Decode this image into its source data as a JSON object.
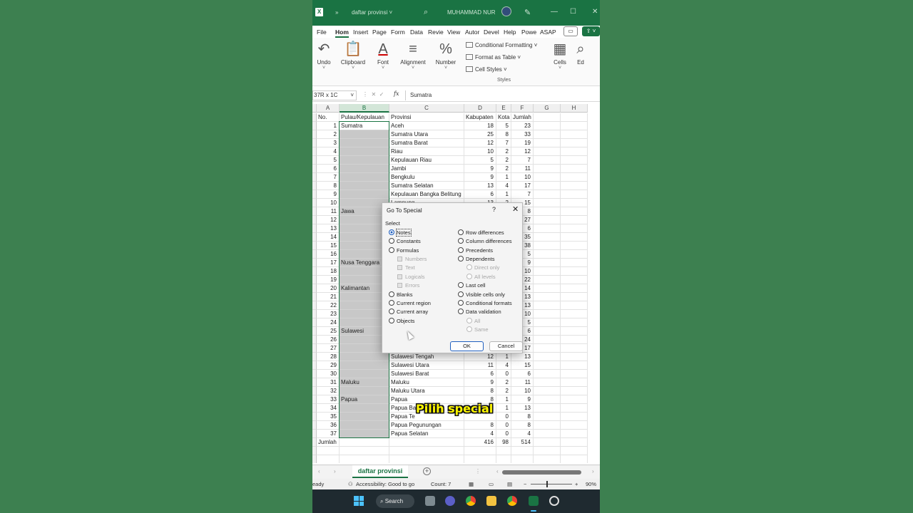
{
  "window": {
    "app_logo": "X",
    "quick_access": "»",
    "filename": "daftar provinsi",
    "user": "MUHAMMAD NUR",
    "minimize": "—",
    "restore": "☐",
    "close": "✕"
  },
  "menu_tabs": [
    "File",
    "Hom",
    "Insert",
    "Page",
    "Form",
    "Data",
    "Revie",
    "View",
    "Autor",
    "Devel",
    "Help",
    "Powe",
    "ASAP"
  ],
  "ribbon": {
    "undo": "Undo",
    "clipboard": "Clipboard",
    "font": "Font",
    "alignment": "Alignment",
    "number": "Number",
    "conditional_formatting": "Conditional Formatting ˅",
    "format_as_table": "Format as Table ˅",
    "cell_styles": "Cell Styles ˅",
    "styles_group": "Styles",
    "cells": "Cells",
    "editing": "Ed"
  },
  "formula_bar": {
    "name_box": "37R x 1C",
    "value": "Sumatra",
    "fx": "fx"
  },
  "columns": [
    "A",
    "B",
    "C",
    "D",
    "E",
    "F",
    "G",
    "H"
  ],
  "header_row": {
    "a": "No.",
    "b": "Pulau/Kepulauan",
    "c": "Provinsi",
    "d": "Kabupaten",
    "e": "Kota",
    "f": "Jumlah"
  },
  "rows": [
    {
      "no": "1",
      "pulau": "Sumatra",
      "prov": "Aceh",
      "kab": "18",
      "kota": "5",
      "jml": "23"
    },
    {
      "no": "2",
      "pulau": "",
      "prov": "Sumatra Utara",
      "kab": "25",
      "kota": "8",
      "jml": "33"
    },
    {
      "no": "3",
      "pulau": "",
      "prov": "Sumatra Barat",
      "kab": "12",
      "kota": "7",
      "jml": "19"
    },
    {
      "no": "4",
      "pulau": "",
      "prov": "Riau",
      "kab": "10",
      "kota": "2",
      "jml": "12"
    },
    {
      "no": "5",
      "pulau": "",
      "prov": "Kepulauan Riau",
      "kab": "5",
      "kota": "2",
      "jml": "7"
    },
    {
      "no": "6",
      "pulau": "",
      "prov": "Jambi",
      "kab": "9",
      "kota": "2",
      "jml": "11"
    },
    {
      "no": "7",
      "pulau": "",
      "prov": "Bengkulu",
      "kab": "9",
      "kota": "1",
      "jml": "10"
    },
    {
      "no": "8",
      "pulau": "",
      "prov": "Sumatra Selatan",
      "kab": "13",
      "kota": "4",
      "jml": "17"
    },
    {
      "no": "9",
      "pulau": "",
      "prov": "Kepulauan Bangka Belitung",
      "kab": "6",
      "kota": "1",
      "jml": "7"
    },
    {
      "no": "10",
      "pulau": "",
      "prov": "Lampung",
      "kab": "13",
      "kota": "2",
      "jml": "15"
    },
    {
      "no": "11",
      "pulau": "Jawa",
      "prov": "",
      "kab": "",
      "kota": "",
      "jml": "8"
    },
    {
      "no": "12",
      "pulau": "",
      "prov": "",
      "kab": "",
      "kota": "",
      "jml": "27"
    },
    {
      "no": "13",
      "pulau": "",
      "prov": "",
      "kab": "",
      "kota": "",
      "jml": "6"
    },
    {
      "no": "14",
      "pulau": "",
      "prov": "",
      "kab": "",
      "kota": "",
      "jml": "35"
    },
    {
      "no": "15",
      "pulau": "",
      "prov": "",
      "kab": "",
      "kota": "",
      "jml": "38"
    },
    {
      "no": "16",
      "pulau": "",
      "prov": "",
      "kab": "",
      "kota": "",
      "jml": "5"
    },
    {
      "no": "17",
      "pulau": "Nusa Tenggara",
      "prov": "",
      "kab": "",
      "kota": "",
      "jml": "9"
    },
    {
      "no": "18",
      "pulau": "",
      "prov": "",
      "kab": "",
      "kota": "",
      "jml": "10"
    },
    {
      "no": "19",
      "pulau": "",
      "prov": "",
      "kab": "",
      "kota": "",
      "jml": "22"
    },
    {
      "no": "20",
      "pulau": "Kalimantan",
      "prov": "",
      "kab": "",
      "kota": "",
      "jml": "14"
    },
    {
      "no": "21",
      "pulau": "",
      "prov": "",
      "kab": "",
      "kota": "",
      "jml": "13"
    },
    {
      "no": "22",
      "pulau": "",
      "prov": "",
      "kab": "",
      "kota": "",
      "jml": "13"
    },
    {
      "no": "23",
      "pulau": "",
      "prov": "",
      "kab": "",
      "kota": "",
      "jml": "10"
    },
    {
      "no": "24",
      "pulau": "",
      "prov": "",
      "kab": "",
      "kota": "",
      "jml": "5"
    },
    {
      "no": "25",
      "pulau": "Sulawesi",
      "prov": "",
      "kab": "",
      "kota": "",
      "jml": "6"
    },
    {
      "no": "26",
      "pulau": "",
      "prov": "",
      "kab": "",
      "kota": "",
      "jml": "24"
    },
    {
      "no": "27",
      "pulau": "",
      "prov": "",
      "kab": "",
      "kota": "",
      "jml": "17"
    },
    {
      "no": "28",
      "pulau": "",
      "prov": "Sulawesi Tengah",
      "kab": "12",
      "kota": "1",
      "jml": "13"
    },
    {
      "no": "29",
      "pulau": "",
      "prov": "Sulawesi Utara",
      "kab": "11",
      "kota": "4",
      "jml": "15"
    },
    {
      "no": "30",
      "pulau": "",
      "prov": "Sulawesi Barat",
      "kab": "6",
      "kota": "0",
      "jml": "6"
    },
    {
      "no": "31",
      "pulau": "Maluku",
      "prov": "Maluku",
      "kab": "9",
      "kota": "2",
      "jml": "11"
    },
    {
      "no": "32",
      "pulau": "",
      "prov": "Maluku Utara",
      "kab": "8",
      "kota": "2",
      "jml": "10"
    },
    {
      "no": "33",
      "pulau": "Papua",
      "prov": "Papua",
      "kab": "8",
      "kota": "1",
      "jml": "9"
    },
    {
      "no": "34",
      "pulau": "",
      "prov": "Papua Ba",
      "kab": "",
      "kota": "1",
      "jml": "13"
    },
    {
      "no": "35",
      "pulau": "",
      "prov": "Papua Te",
      "kab": "",
      "kota": "0",
      "jml": "8"
    },
    {
      "no": "36",
      "pulau": "",
      "prov": "Papua Pegunungan",
      "kab": "8",
      "kota": "0",
      "jml": "8"
    },
    {
      "no": "37",
      "pulau": "",
      "prov": "Papua Selatan",
      "kab": "4",
      "kota": "0",
      "jml": "4"
    }
  ],
  "total_row": {
    "label": "Jumlah",
    "kab": "416",
    "kota": "98",
    "jml": "514"
  },
  "sheet_tab": "daftar provinsi",
  "status": {
    "ready": "eady",
    "accessibility": "Accessibility: Good to go",
    "count": "Count: 7",
    "zoom": "90%"
  },
  "taskbar": {
    "search": "Search"
  },
  "dialog": {
    "title": "Go To Special",
    "help": "?",
    "close": "✕",
    "section": "Select",
    "left_options": [
      "Notes",
      "Constants",
      "Formulas",
      "Numbers",
      "Text",
      "Logicals",
      "Errors",
      "Blanks",
      "Current region",
      "Current array",
      "Objects"
    ],
    "right_options": [
      "Row differences",
      "Column differences",
      "Precedents",
      "Dependents",
      "Direct only",
      "All levels",
      "Last cell",
      "Visible cells only",
      "Conditional formats",
      "Data validation",
      "All",
      "Same"
    ],
    "ok": "OK",
    "cancel": "Cancel",
    "selected": "Notes"
  },
  "caption": "Pilih special",
  "colors": {
    "excel_green": "#1a7343",
    "background": "#3d8050",
    "caption_yellow": "#fff700",
    "radio_blue": "#1f5fbf"
  }
}
